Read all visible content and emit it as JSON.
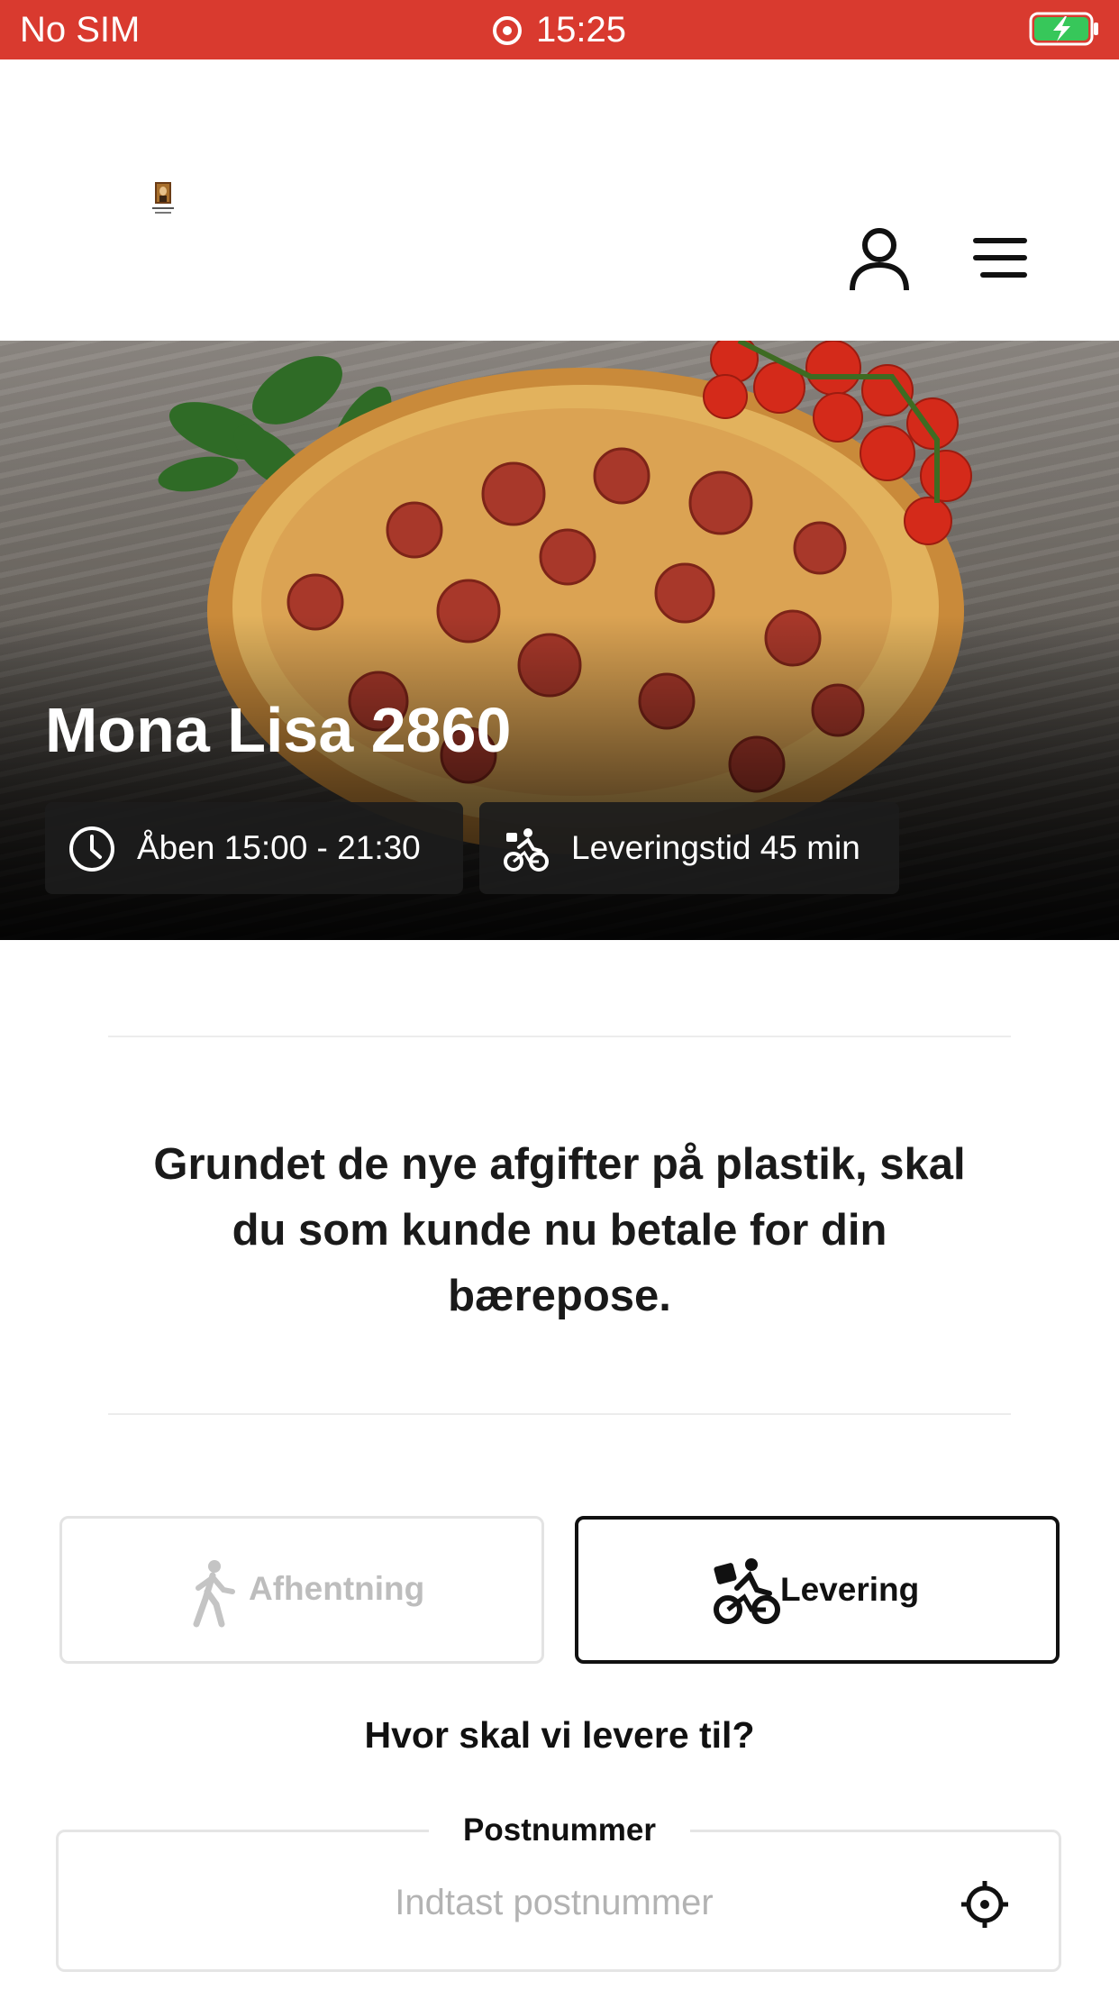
{
  "status_bar": {
    "carrier": "No SIM",
    "time": "15:25",
    "battery_state": "charging"
  },
  "header": {
    "logo_alt": "Mona Lisa logo",
    "user_icon": "user-icon",
    "menu_icon": "menu-icon"
  },
  "hero": {
    "restaurant_name": "Mona Lisa 2860",
    "opening_hours": "Åben 15:00 - 21:30",
    "delivery_time": "Leveringstid 45 min",
    "clock_icon": "clock-icon",
    "bike_icon": "delivery-bike-icon"
  },
  "notice": {
    "text": "Grundet de nye afgifter på plastik, skal du som kunde nu betale for din bærepose."
  },
  "order_mode": {
    "pickup_label": "Afhentning",
    "delivery_label": "Levering",
    "selected": "delivery"
  },
  "delivery_form": {
    "question": "Hvor skal vi levere til?",
    "postal_legend": "Postnummer",
    "postal_placeholder": "Indtast postnummer",
    "postal_value": ""
  },
  "colors": {
    "status_bar": "#d93a2f",
    "text_dark": "#1a1a1a",
    "disabled_text": "#bdbdbd",
    "border_light": "#e5e5e5",
    "selected_border": "#111111"
  }
}
